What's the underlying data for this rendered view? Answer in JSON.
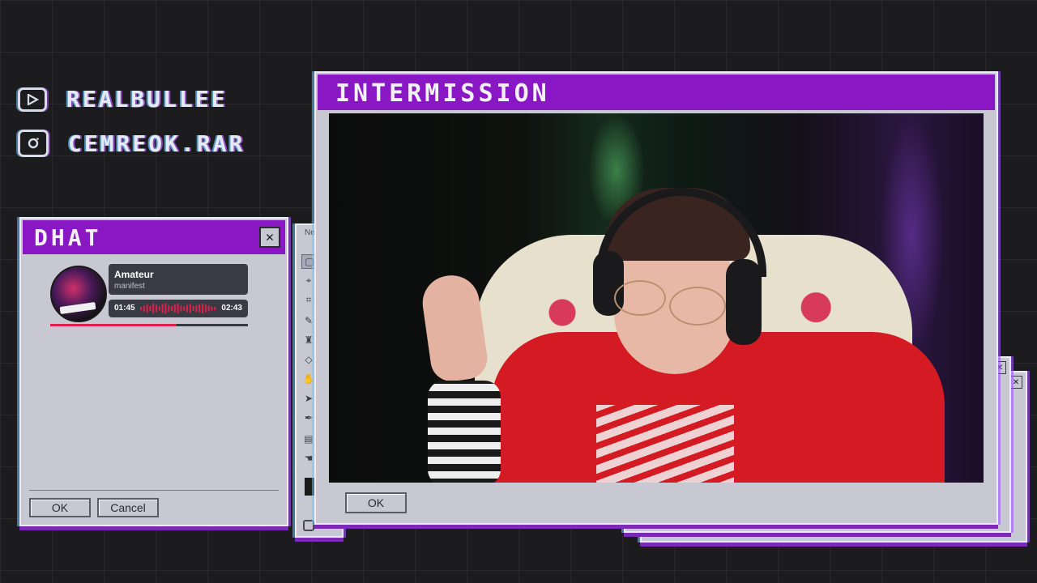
{
  "social": {
    "youtube_icon": "youtube-icon",
    "youtube_handle": "REALBULLEE",
    "instagram_icon": "instagram-icon",
    "instagram_handle": "CEMREOK.RAR"
  },
  "chat_window": {
    "title": "DHAT",
    "close_glyph": "✕",
    "ok_label": "OK",
    "cancel_label": "Cancel",
    "player": {
      "track_title": "Amateur",
      "artist": "manifest",
      "elapsed": "01:45",
      "duration": "02:43",
      "progress_fraction": 0.64
    }
  },
  "behind_window": {
    "title_fragment": "Ne"
  },
  "main_window": {
    "title": "INTERMISSION",
    "ok_label": "OK"
  },
  "colors": {
    "accent_purple": "#8a17c4",
    "window_gray": "#c8c8d2",
    "player_accent_red": "#e0204a"
  }
}
